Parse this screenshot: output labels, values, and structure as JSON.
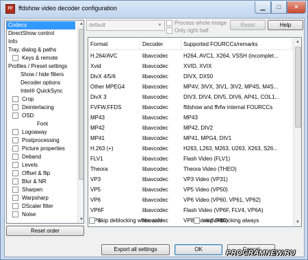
{
  "window": {
    "title": "ffdshow video decoder configuration",
    "icon_text": "FF"
  },
  "tree": [
    {
      "label": "Codecs",
      "check": false,
      "indent": 0,
      "selected": true
    },
    {
      "label": "DirectShow control",
      "check": false,
      "indent": 0
    },
    {
      "label": "Info",
      "check": false,
      "indent": 0
    },
    {
      "label": "Tray, dialog & paths",
      "check": false,
      "indent": 0
    },
    {
      "label": "Keys & remote",
      "check": true,
      "indent": 1
    },
    {
      "label": "Profiles / Preset settings",
      "check": false,
      "indent": 0
    },
    {
      "label": "Show / hide filters",
      "check": false,
      "indent": 2
    },
    {
      "label": "Decoder options",
      "check": false,
      "indent": 2
    },
    {
      "label": "Intel® QuickSync",
      "check": false,
      "indent": 2
    },
    {
      "label": "Crop",
      "check": true,
      "indent": 1
    },
    {
      "label": "Deinterlacing",
      "check": true,
      "indent": 1
    },
    {
      "label": "OSD",
      "check": true,
      "indent": 1
    },
    {
      "label": "Font",
      "check": false,
      "indent": 3
    },
    {
      "label": "Logoaway",
      "check": true,
      "indent": 1
    },
    {
      "label": "Postprocessing",
      "check": true,
      "indent": 1
    },
    {
      "label": "Picture properties",
      "check": true,
      "indent": 1
    },
    {
      "label": "Deband",
      "check": true,
      "indent": 1
    },
    {
      "label": "Levels",
      "check": true,
      "indent": 1
    },
    {
      "label": "Offset & flip",
      "check": true,
      "indent": 1
    },
    {
      "label": "Blur & NR",
      "check": true,
      "indent": 1
    },
    {
      "label": "Sharpen",
      "check": true,
      "indent": 1
    },
    {
      "label": "Warpsharp",
      "check": true,
      "indent": 1
    },
    {
      "label": "DScaler filter",
      "check": true,
      "indent": 1
    },
    {
      "label": "Noise",
      "check": true,
      "indent": 1
    }
  ],
  "preset_combo": {
    "value": "default"
  },
  "options": {
    "process_whole_image": "Process whole image",
    "only_right_half": "Only right half"
  },
  "buttons": {
    "reset": "Reset",
    "help": "Help",
    "reset_order": "Reset order",
    "export_all": "Export all settings",
    "ok": "OK",
    "cancel": "Cancel"
  },
  "table": {
    "headers": [
      "Format",
      "Decoder",
      "Supported FOURCCs/remarks"
    ],
    "rows": [
      [
        "H.264/AVC",
        "libavcodec",
        "H264, AVC1, X264, VSSH (incomplet..."
      ],
      [
        "Xvid",
        "libavcodec",
        "XVID, XVIX"
      ],
      [
        "DivX 4/5/6",
        "libavcodec",
        "DIVX, DX50"
      ],
      [
        "Other MPEG4",
        "libavcodec",
        "MP4V, 3IVX, 3IV1, 3IV2, MP4S, M4S..."
      ],
      [
        "DivX 3",
        "libavcodec",
        "DIV3, DIV4, DIV5, DIV6, AP41, COL1..."
      ],
      [
        "FVFW,FFDS",
        "libavcodec",
        "ffdshow and ffvfw internal FOURCCs"
      ],
      [
        "MP43",
        "libavcodec",
        "MP43"
      ],
      [
        "MP42",
        "libavcodec",
        "MP42, DIV2"
      ],
      [
        "MP41",
        "libavcodec",
        "MP41, MPG4, DIV1"
      ],
      [
        "H.263 (+)",
        "libavcodec",
        "H263, L263, M263, U263, X263, S26..."
      ],
      [
        "FLV1",
        "libavcodec",
        "Flash Video (FLV1)"
      ],
      [
        "Theora",
        "libavcodec",
        "Theora Video (THEO)"
      ],
      [
        "VP3",
        "libavcodec",
        "VP3 Video (VP31)"
      ],
      [
        "VP5",
        "libavcodec",
        "VP5 Video (VP50)"
      ],
      [
        "VP6",
        "libavcodec",
        "VP6 Video (VP60, VP61, VP62)"
      ],
      [
        "VP6F",
        "libavcodec",
        "Flash Video (VP6F, FLV4, VP6A)"
      ],
      [
        "VP8",
        "libavcodec",
        "VP8 Video (VP80)"
      ]
    ]
  },
  "bottom_checks": {
    "skip_safe": "skip deblocking when safe",
    "skip_always": "skip deblocking always"
  },
  "watermark": "PROGRAMNEW.RU"
}
